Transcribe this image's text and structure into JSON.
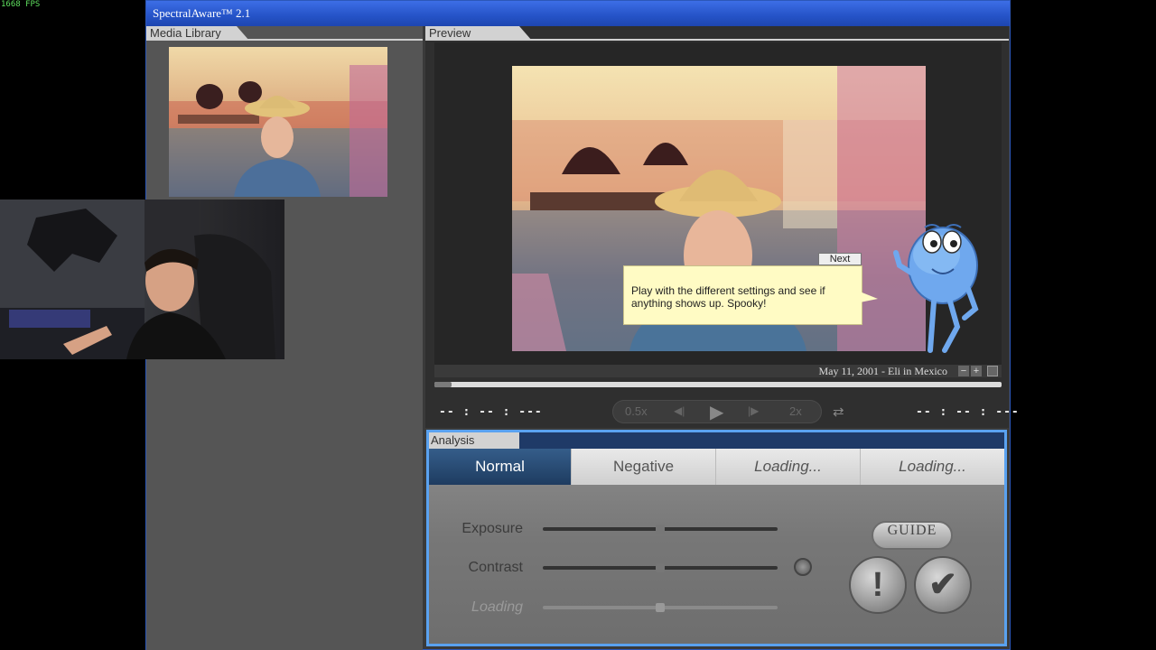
{
  "overlay": {
    "fps": "1668 FPS"
  },
  "window": {
    "title": "SpectralAware™ 2.1"
  },
  "media_library": {
    "header": "Media Library"
  },
  "preview": {
    "header": "Preview",
    "caption": "May 11, 2001 - Eli in Mexico",
    "zoom_out": "−",
    "zoom_in": "+",
    "progress_fraction": 0.03,
    "time_current": "-- : -- : ---",
    "time_total": "-- : -- : ---",
    "transport": {
      "slower": "0.5x",
      "faster": "2x"
    }
  },
  "tutorial": {
    "next_label": "Next",
    "message": "Play with the different settings and see if anything shows up. Spooky!"
  },
  "analysis": {
    "header": "Analysis",
    "tabs": [
      {
        "label": "Normal",
        "active": true
      },
      {
        "label": "Negative",
        "active": false
      },
      {
        "label": "Loading...",
        "active": false
      },
      {
        "label": "Loading...",
        "active": false
      }
    ],
    "sliders": [
      {
        "label": "Exposure",
        "value": 0.5,
        "enabled": true
      },
      {
        "label": "Contrast",
        "value": 0.5,
        "enabled": true
      },
      {
        "label": "Loading",
        "value": 0.5,
        "enabled": false
      }
    ],
    "guide_label": "GUIDE",
    "alert_glyph": "!",
    "confirm_glyph": "✔"
  },
  "colors": {
    "titlebar": "#2553c7",
    "analysis_border": "#5aa2f0",
    "tab_active": "#1e3c60",
    "bubble": "#fffbc4"
  }
}
